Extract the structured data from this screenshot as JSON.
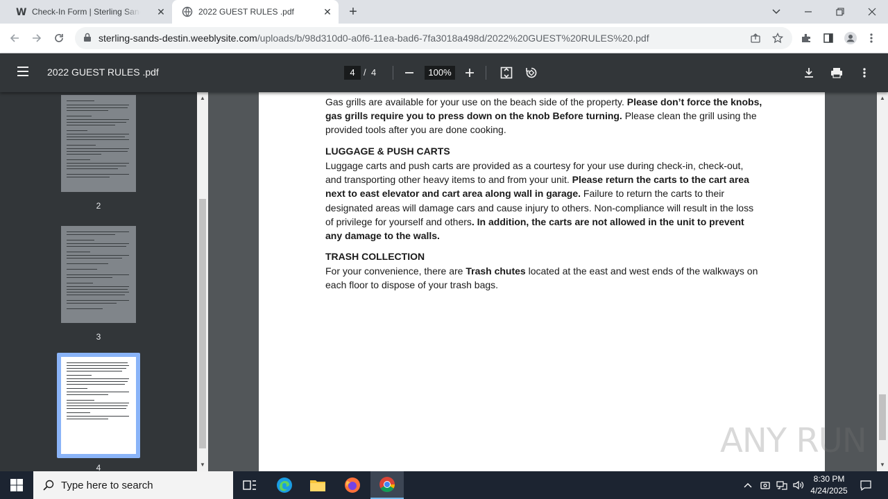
{
  "browser": {
    "tabs": [
      {
        "title": "Check-In Form | Sterling Sands C",
        "active": false
      },
      {
        "title": "2022 GUEST RULES .pdf",
        "active": true
      }
    ],
    "url_domain": "sterling-sands-destin.weeblysite.com",
    "url_path": "/uploads/b/98d310d0-a0f6-11ea-bad6-7fa3018a498d/2022%20GUEST%20RULES%20.pdf"
  },
  "pdf": {
    "title": "2022 GUEST RULES .pdf",
    "current_page": "4",
    "page_sep": "/",
    "total_pages": "4",
    "zoom": "100%"
  },
  "thumbnails": [
    {
      "number": "2"
    },
    {
      "number": "3"
    },
    {
      "number": "4"
    }
  ],
  "content": {
    "grill_line1_normal": "Gas grills are available for your use on the beach side of the property. ",
    "grill_line1_bold": "Please don’t force the knobs,",
    "grill_line2_bold": "gas grills require you to press down on the knob Before turning.",
    "grill_line2_normal": "  Please clean the grill using the",
    "grill_line3": "provided tools after you are done cooking.",
    "luggage_heading": "LUGGAGE & PUSH CARTS",
    "luggage_line1": "Luggage carts and push carts are provided as a courtesy for your use during check-in, check-out,",
    "luggage_line2_normal": "and transporting other heavy items to and from your unit. ",
    "luggage_line2_bold": "Please return the carts to the cart area",
    "luggage_line3_bold": "next to east elevator and cart area along wall in garage.",
    "luggage_line3_normal": " Failure to return the carts to their",
    "luggage_line4": "designated areas will damage cars and cause injury to others. Non-compliance will result in the loss",
    "luggage_line5_normal": "of privilege for yourself and others",
    "luggage_line5_bold": ". In addition, the carts are not allowed in the unit to prevent",
    "luggage_line6_bold": "any damage to the walls.",
    "trash_heading": "TRASH COLLECTION",
    "trash_line1_a": "For your convenience, there are ",
    "trash_line1_bold": "Trash chutes",
    "trash_line1_b": " located at the east and west ends of the walkways on",
    "trash_line2": "each floor to dispose of your trash bags."
  },
  "watermark": "ANY RUN",
  "taskbar": {
    "search_placeholder": "Type here to search",
    "time": "8:30 PM",
    "date": "4/24/2025"
  }
}
